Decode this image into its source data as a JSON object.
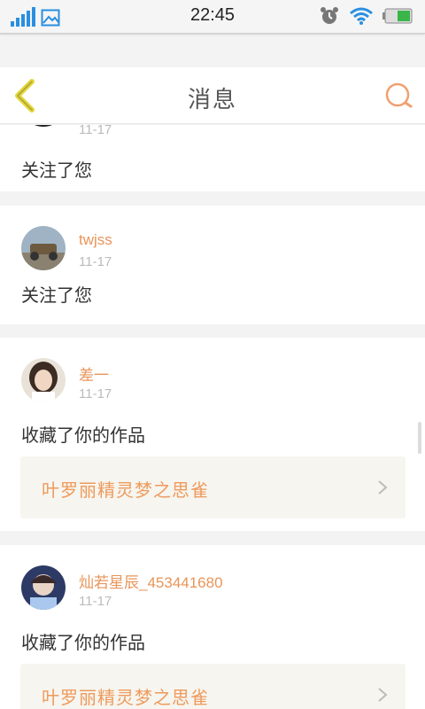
{
  "status_bar": {
    "time": "22:45",
    "signal_icon": "signal-bars-icon",
    "gallery_icon": "image-icon",
    "alarm_icon": "alarm-clock-icon",
    "wifi_icon": "wifi-icon",
    "battery_icon": "battery-icon",
    "battery_level": 0.5
  },
  "header": {
    "title": "消息",
    "back_icon": "chevron-left-icon",
    "search_icon": "search-icon"
  },
  "colors": {
    "accent": "#e8955a",
    "back_arrow": "#e3d63a",
    "search": "#f0a070"
  },
  "notifications": [
    {
      "username": "",
      "date": "11-17",
      "action": "关注了您",
      "work": ""
    },
    {
      "username": "twjss",
      "date": "11-17",
      "action": "关注了您",
      "work": ""
    },
    {
      "username": "差一",
      "date": "11-17",
      "action": "收藏了你的作品",
      "work": "叶罗丽精灵梦之思雀"
    },
    {
      "username": "灿若星辰_453441680",
      "date": "11-17",
      "action": "收藏了你的作品",
      "work": "叶罗丽精灵梦之思雀"
    }
  ]
}
